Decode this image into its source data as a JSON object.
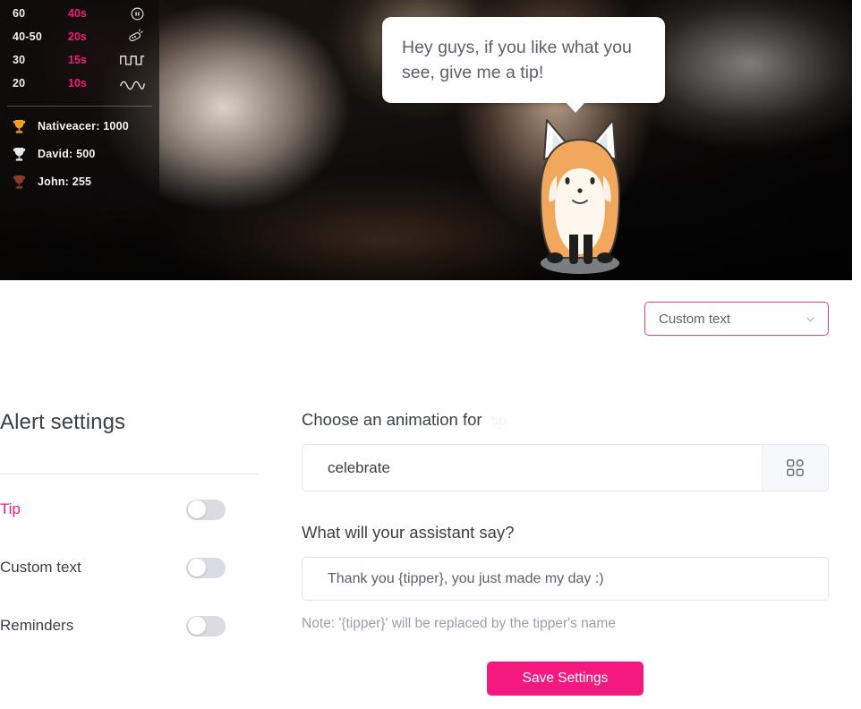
{
  "video_overlay": {
    "tip_menu": {
      "rows": [
        {
          "amount": "60",
          "duration": "40s",
          "icon": "pause-circle-icon"
        },
        {
          "amount": "40-50",
          "duration": "20s",
          "icon": "vibrator-remote-icon"
        },
        {
          "amount": "30",
          "duration": "15s",
          "icon": "square-wave-icon"
        },
        {
          "amount": "20",
          "duration": "10s",
          "icon": "sine-wave-icon"
        }
      ]
    },
    "leaderboard": {
      "rows": [
        {
          "rank_icon": "gold-trophy-icon",
          "text": "Nativeacer: 1000"
        },
        {
          "rank_icon": "silver-trophy-icon",
          "text": "David: 500"
        },
        {
          "rank_icon": "bronze-trophy-icon",
          "text": "John: 255"
        }
      ]
    },
    "speech_bubble": {
      "text": "Hey guys, if you like what you see, give me a tip!"
    },
    "mascot": {
      "name": "fox-mascot"
    }
  },
  "alert_type_dropdown": {
    "selected": "Custom text",
    "caret_icon": "chevron-down-icon",
    "border_color": "#e0418f"
  },
  "sidebar": {
    "title": "Alert settings",
    "items": [
      {
        "label": "Tip",
        "enabled": false,
        "active": true
      },
      {
        "label": "Custom text",
        "enabled": false,
        "active": false
      },
      {
        "label": "Reminders",
        "enabled": false,
        "active": false
      }
    ]
  },
  "form": {
    "animation_label": "Choose an animation for",
    "animation_label_faint": "tip",
    "animation_value": "celebrate",
    "grid_icon": "apps-grid-icon",
    "say_label": "What will your assistant say?",
    "say_value": "Thank you {tipper}, you just made my day :)",
    "note": "Note: '{tipper}' will be replaced by the tipper's name",
    "save_label": "Save Settings",
    "accent_color": "#f4197f"
  }
}
